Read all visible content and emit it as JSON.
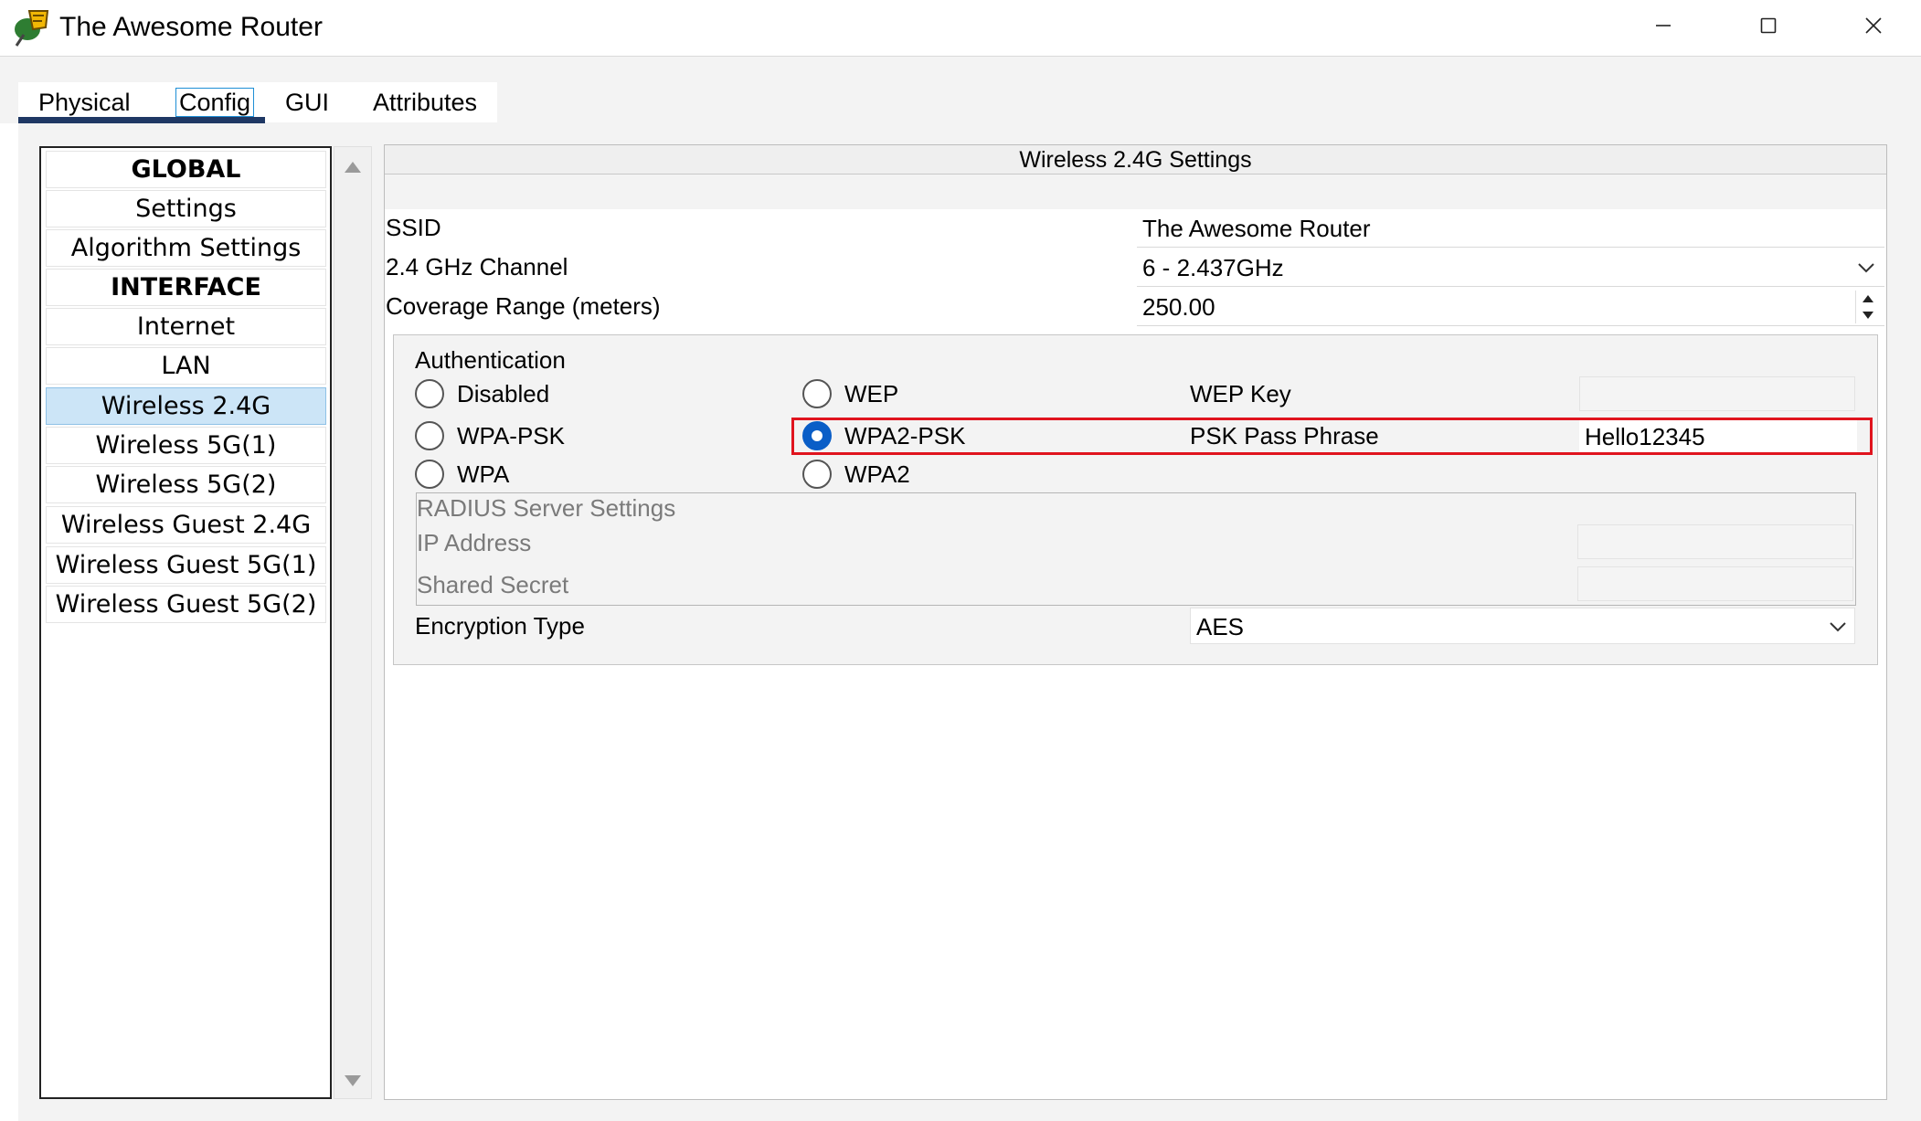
{
  "window": {
    "title": "The Awesome Router",
    "controls": [
      "minimize-icon",
      "maximize-icon",
      "close-icon"
    ]
  },
  "tabs": [
    {
      "label": "Physical"
    },
    {
      "label": "Config",
      "active": true
    },
    {
      "label": "GUI"
    },
    {
      "label": "Attributes"
    }
  ],
  "sidebar": {
    "items": [
      {
        "label": "GLOBAL",
        "header": true
      },
      {
        "label": "Settings"
      },
      {
        "label": "Algorithm Settings"
      },
      {
        "label": "INTERFACE",
        "header": true
      },
      {
        "label": "Internet"
      },
      {
        "label": "LAN"
      },
      {
        "label": "Wireless 2.4G",
        "selected": true
      },
      {
        "label": "Wireless 5G(1)"
      },
      {
        "label": "Wireless 5G(2)"
      },
      {
        "label": "Wireless Guest 2.4G"
      },
      {
        "label": "Wireless Guest 5G(1)"
      },
      {
        "label": "Wireless Guest 5G(2)"
      }
    ]
  },
  "panel": {
    "title": "Wireless 2.4G Settings",
    "ssid_label": "SSID",
    "ssid_value": "The Awesome Router",
    "channel_label": "2.4 GHz Channel",
    "channel_value": "6 - 2.437GHz",
    "coverage_label": "Coverage Range (meters)",
    "coverage_value": "250.00",
    "auth": {
      "heading": "Authentication",
      "options": {
        "disabled": "Disabled",
        "wep": "WEP",
        "wpa_psk": "WPA-PSK",
        "wpa2_psk": "WPA2-PSK",
        "wpa": "WPA",
        "wpa2": "WPA2"
      },
      "selected": "WPA2-PSK",
      "wep_key_label": "WEP Key",
      "wep_key_value": "",
      "psk_label": "PSK Pass Phrase",
      "psk_value": "Hello12345"
    },
    "radius": {
      "heading": "RADIUS Server Settings",
      "ip_label": "IP Address",
      "ip_value": "",
      "secret_label": "Shared Secret",
      "secret_value": ""
    },
    "encryption_label": "Encryption Type",
    "encryption_value": "AES"
  },
  "colors": {
    "selection": "#cce5f7",
    "tab_underline": "#1f3864",
    "radio_checked": "#0a5ec7",
    "highlight": "#e0141e"
  }
}
